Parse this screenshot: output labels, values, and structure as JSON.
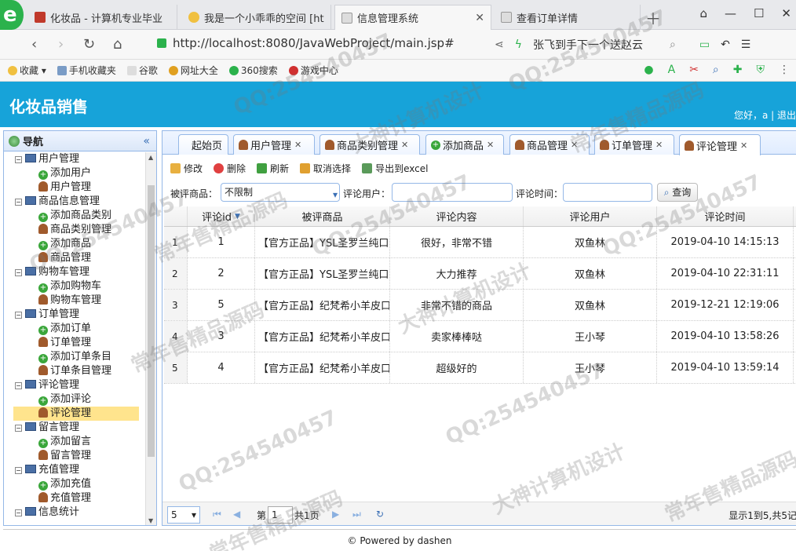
{
  "browser": {
    "tabs": [
      {
        "title": "化妆品 - 计算机专业毕业",
        "active": false
      },
      {
        "title": "我是一个小乖乖的空间 [ht",
        "active": false
      },
      {
        "title": "信息管理系统",
        "active": true
      },
      {
        "title": "查看订单详情",
        "active": false
      }
    ],
    "url": "http://localhost:8080/JavaWebProject/main.jsp#",
    "search_hint": "张飞到手下一个送赵云",
    "bookmarks": [
      "收藏",
      "手机收藏夹",
      "谷歌",
      "网址大全",
      "360搜索",
      "游戏中心"
    ]
  },
  "app": {
    "title": "化妆品销售",
    "welcome": "您好，a | 退出"
  },
  "sidebar": {
    "title": "导航",
    "groups": [
      {
        "label": "用户管理",
        "items": [
          {
            "label": "添加用户",
            "icon": "add-icon"
          },
          {
            "label": "用户管理",
            "icon": "user-icon"
          }
        ]
      },
      {
        "label": "商品信息管理",
        "items": [
          {
            "label": "添加商品类别",
            "icon": "add-icon"
          },
          {
            "label": "商品类别管理",
            "icon": "user-icon"
          },
          {
            "label": "添加商品",
            "icon": "add-icon"
          },
          {
            "label": "商品管理",
            "icon": "user-icon"
          }
        ]
      },
      {
        "label": "购物车管理",
        "items": [
          {
            "label": "添加购物车",
            "icon": "add-icon"
          },
          {
            "label": "购物车管理",
            "icon": "user-icon"
          }
        ]
      },
      {
        "label": "订单管理",
        "items": [
          {
            "label": "添加订单",
            "icon": "add-icon"
          },
          {
            "label": "订单管理",
            "icon": "user-icon"
          },
          {
            "label": "添加订单条目",
            "icon": "add-icon"
          },
          {
            "label": "订单条目管理",
            "icon": "user-icon"
          }
        ]
      },
      {
        "label": "评论管理",
        "items": [
          {
            "label": "添加评论",
            "icon": "add-icon"
          },
          {
            "label": "评论管理",
            "icon": "user-icon",
            "selected": true
          }
        ]
      },
      {
        "label": "留言管理",
        "items": [
          {
            "label": "添加留言",
            "icon": "add-icon"
          },
          {
            "label": "留言管理",
            "icon": "user-icon"
          }
        ]
      },
      {
        "label": "充值管理",
        "items": [
          {
            "label": "添加充值",
            "icon": "add-icon"
          },
          {
            "label": "充值管理",
            "icon": "user-icon"
          }
        ]
      },
      {
        "label": "信息统计",
        "items": []
      }
    ]
  },
  "tabs": [
    {
      "label": "起始页",
      "closable": false
    },
    {
      "label": "用户管理",
      "closable": true
    },
    {
      "label": "商品类别管理",
      "closable": true
    },
    {
      "label": "添加商品",
      "closable": true
    },
    {
      "label": "商品管理",
      "closable": true
    },
    {
      "label": "订单管理",
      "closable": true
    },
    {
      "label": "评论管理",
      "closable": true,
      "active": true
    }
  ],
  "toolbar": {
    "edit": "修改",
    "delete": "删除",
    "refresh": "刷新",
    "cancel_select": "取消选择",
    "export": "导出到excel"
  },
  "filter": {
    "product_label": "被评商品：",
    "product_value": "不限制",
    "user_label": "评论用户：",
    "user_value": "",
    "time_label": "评论时间：",
    "time_value": "",
    "query": "查询"
  },
  "grid": {
    "columns": [
      "评论id",
      "被评商品",
      "评论内容",
      "评论用户",
      "评论时间"
    ],
    "rows": [
      {
        "rn": "1",
        "id": "1",
        "product": "【官方正品】YSL圣罗兰纯口",
        "content": "很好，非常不错",
        "user": "双鱼林",
        "time": "2019-04-10 14:15:13"
      },
      {
        "rn": "2",
        "id": "2",
        "product": "【官方正品】YSL圣罗兰纯口",
        "content": "大力推荐",
        "user": "双鱼林",
        "time": "2019-04-10 22:31:11"
      },
      {
        "rn": "3",
        "id": "5",
        "product": "【官方正品】纪梵希小羊皮口",
        "content": "非常不错的商品",
        "user": "双鱼林",
        "time": "2019-12-21 12:19:06"
      },
      {
        "rn": "4",
        "id": "3",
        "product": "【官方正品】纪梵希小羊皮口",
        "content": "卖家棒棒哒",
        "user": "王小琴",
        "time": "2019-04-10 13:58:26"
      },
      {
        "rn": "5",
        "id": "4",
        "product": "【官方正品】纪梵希小羊皮口",
        "content": "超级好的",
        "user": "王小琴",
        "time": "2019-04-10 13:59:14"
      }
    ]
  },
  "pager": {
    "page_size": "5",
    "page_prefix": "第",
    "page_num": "1",
    "page_total": "共1页",
    "info": "显示1到5,共5记"
  },
  "footer": "© Powered by dashen",
  "watermarks": [
    "QQ:254540457",
    "大神计算机设计",
    "常年售精品源码"
  ]
}
